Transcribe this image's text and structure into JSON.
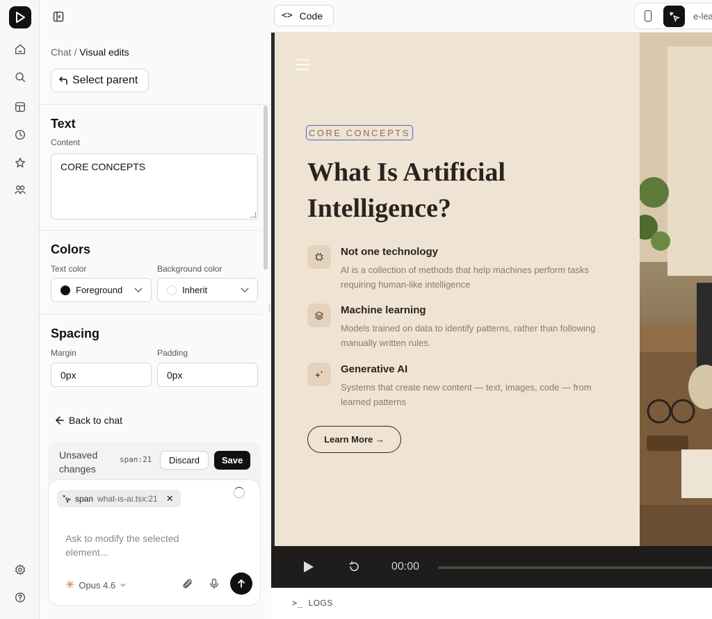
{
  "panel": {
    "breadcrumb_parent": "Chat",
    "breadcrumb_sep": " / ",
    "breadcrumb_current": "Visual edits",
    "select_parent_label": "Select parent",
    "text_section": {
      "title": "Text",
      "content_label": "Content",
      "content_value": "CORE CONCEPTS"
    },
    "colors_section": {
      "title": "Colors",
      "text_color_label": "Text color",
      "text_color_value": "Foreground",
      "background_color_label": "Background color",
      "background_color_value": "Inherit"
    },
    "spacing_section": {
      "title": "Spacing",
      "margin_label": "Margin",
      "margin_value": "0px",
      "padding_label": "Padding",
      "padding_value": "0px"
    },
    "back_to_chat": "Back to chat",
    "unsaved_text": "Unsaved changes",
    "unsaved_tag": "span:21",
    "discard_label": "Discard",
    "save_label": "Save",
    "chip_element": "span",
    "chip_file": "what-is-ai.tsx:21",
    "prompt_placeholder": "Ask to modify the selected element...",
    "model_name": "Opus 4.6"
  },
  "preview": {
    "code_label": "Code",
    "url_fragment": "e-lea",
    "eyebrow": "CORE CONCEPTS",
    "headline": "What Is Artificial Intelligence?",
    "features": [
      {
        "title": "Not one technology",
        "desc": "AI is a collection of methods that help machines perform tasks requiring human-like intelligence"
      },
      {
        "title": "Machine learning",
        "desc": "Models trained on data to identify patterns, rather than following manually written rules."
      },
      {
        "title": "Generative AI",
        "desc": "Systems that create new content — text, images, code — from learned patterns"
      }
    ],
    "cta_label": "Learn More →",
    "player_time": "00:00",
    "logs_label": "LOGS"
  },
  "colors": {
    "accent_dark": "#111111",
    "page_bg": "#efe3d3",
    "selection_outline": "#4b5fd6",
    "player_bg": "#1f1d1b"
  }
}
